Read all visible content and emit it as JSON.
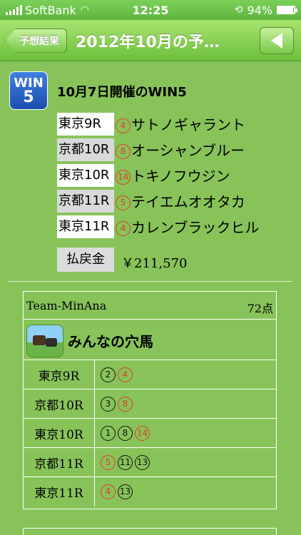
{
  "status": {
    "carrier": "SoftBank",
    "time": "12:25",
    "battery": "94%",
    "battery_level": 0.94
  },
  "nav": {
    "back_label": "予想結果",
    "title": "2012年10月の予…"
  },
  "event": {
    "logo_text_top": "WIN",
    "logo_text_bottom": "5",
    "title": "10月7日開催のWIN5",
    "races": [
      {
        "race": "東京9R",
        "num": "4",
        "horse": "サトノギャラント"
      },
      {
        "race": "京都10R",
        "num": "8",
        "horse": "オーシャンブルー"
      },
      {
        "race": "東京10R",
        "num": "14",
        "horse": "トキノフウジン"
      },
      {
        "race": "京都11R",
        "num": "5",
        "horse": "テイエムオオタカ"
      },
      {
        "race": "東京11R",
        "num": "4",
        "horse": "カレンブラックヒル"
      }
    ],
    "payout_label": "払戻金",
    "payout_value": "￥211,570"
  },
  "team": {
    "name": "Team-MinAna",
    "points": "72点",
    "title": "みんなの穴馬",
    "picks": [
      {
        "race": "東京9R",
        "nums": [
          {
            "n": "2",
            "hit": false
          },
          {
            "n": "4",
            "hit": true
          }
        ]
      },
      {
        "race": "京都10R",
        "nums": [
          {
            "n": "3",
            "hit": false
          },
          {
            "n": "8",
            "hit": true
          }
        ]
      },
      {
        "race": "東京10R",
        "nums": [
          {
            "n": "1",
            "hit": false
          },
          {
            "n": "8",
            "hit": false
          },
          {
            "n": "14",
            "hit": true
          }
        ]
      },
      {
        "race": "京都11R",
        "nums": [
          {
            "n": "5",
            "hit": true
          },
          {
            "n": "11",
            "hit": false
          },
          {
            "n": "13",
            "hit": false
          }
        ]
      },
      {
        "race": "東京11R",
        "nums": [
          {
            "n": "4",
            "hit": true
          },
          {
            "n": "13",
            "hit": false
          }
        ]
      }
    ]
  },
  "colors": {
    "background": "#88c35a",
    "hit": "#e03b2b",
    "miss": "#111111"
  }
}
